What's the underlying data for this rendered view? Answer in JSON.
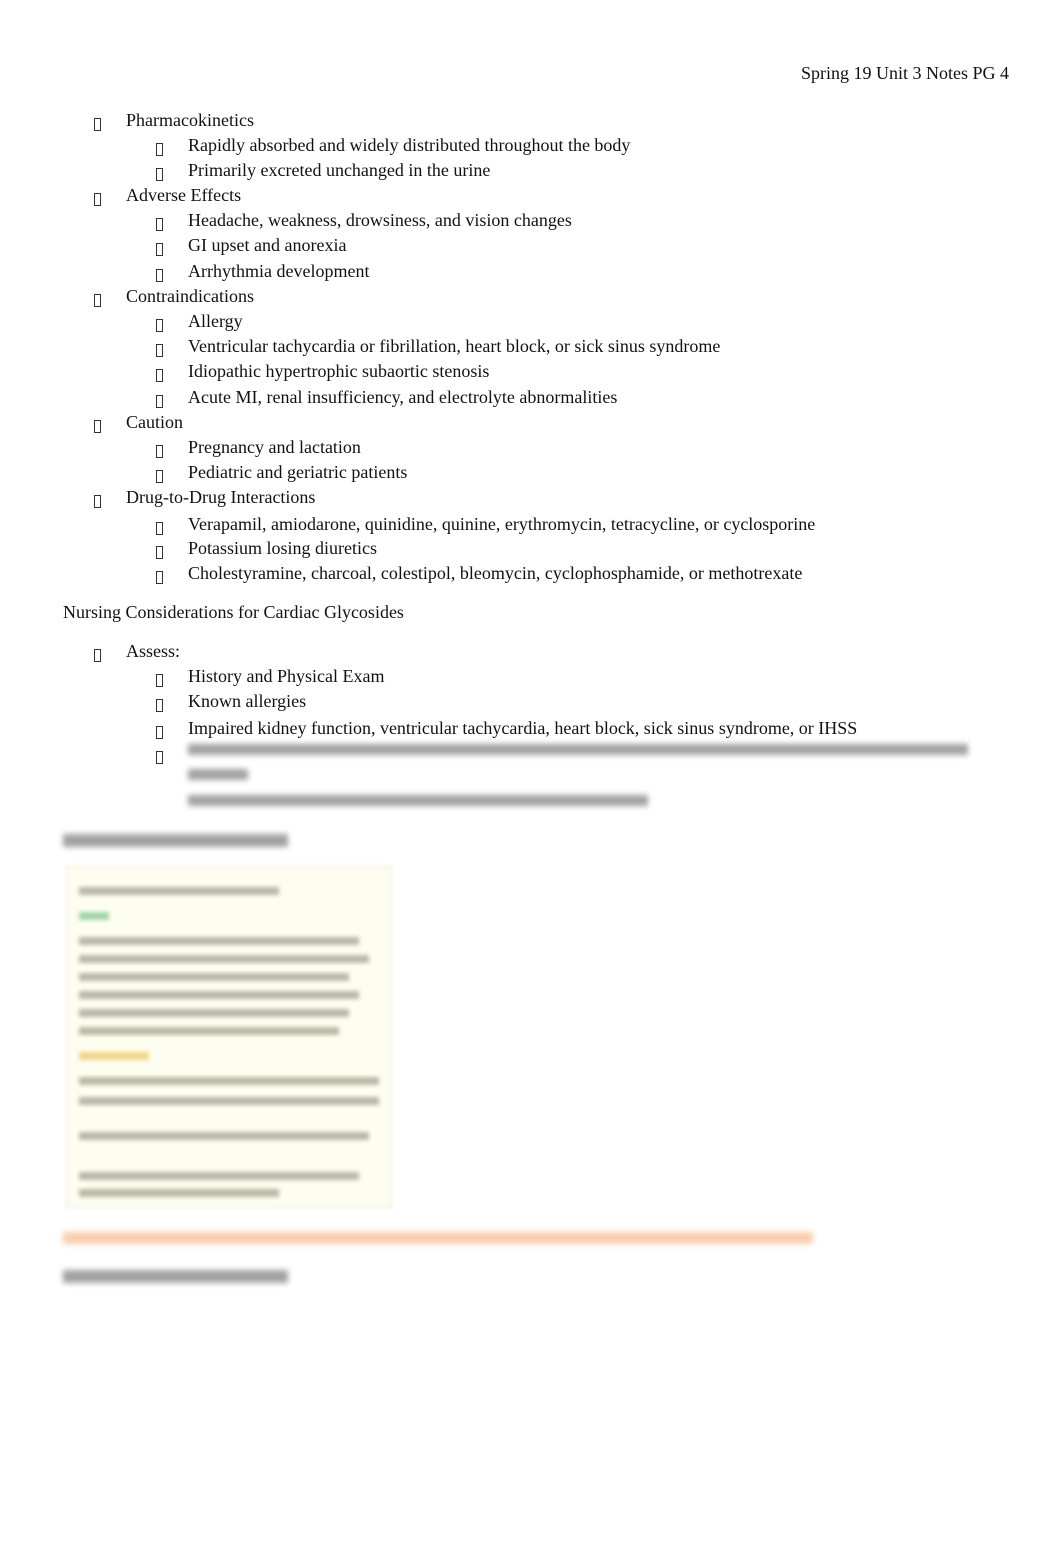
{
  "header": "Spring 19 Unit 3 Notes PG 4",
  "outline": [
    {
      "label": "Pharmacokinetics",
      "items": [
        "Rapidly absorbed and widely distributed throughout the body",
        "Primarily excreted unchanged in the urine"
      ]
    },
    {
      "label": "Adverse Effects",
      "items": [
        "Headache, weakness, drowsiness, and vision changes",
        "GI upset and anorexia",
        "Arrhythmia development"
      ]
    },
    {
      "label": "Contraindications",
      "items": [
        "Allergy",
        "Ventricular tachycardia or fibrillation, heart block, or sick sinus syndrome",
        "Idiopathic hypertrophic subaortic stenosis",
        "Acute MI, renal insufficiency, and electrolyte abnormalities"
      ]
    },
    {
      "label": "Caution",
      "items": [
        "Pregnancy and lactation",
        "Pediatric and geriatric patients"
      ]
    },
    {
      "label": "Drug-to-Drug Interactions",
      "items": [
        "Verapamil, amiodarone, quinidine, quinine, erythromycin, tetracycline, or cyclosporine",
        "Potassium losing diuretics",
        "Cholestyramine, charcoal, colestipol, bleomycin, cyclophosphamide, or methotrexate"
      ]
    }
  ],
  "nursing": {
    "heading": "Nursing Considerations for Cardiac Glycosides",
    "assess_label": "Assess:",
    "items": [
      "History and Physical Exam",
      "Known allergies",
      "Impaired kidney function, ventricular tachycardia, heart block, sick sinus syndrome, or IHSS"
    ]
  },
  "colors": {
    "text": "#111111",
    "blurred_highlight": "#f4a56a",
    "image_bg": "#fdfef0"
  }
}
